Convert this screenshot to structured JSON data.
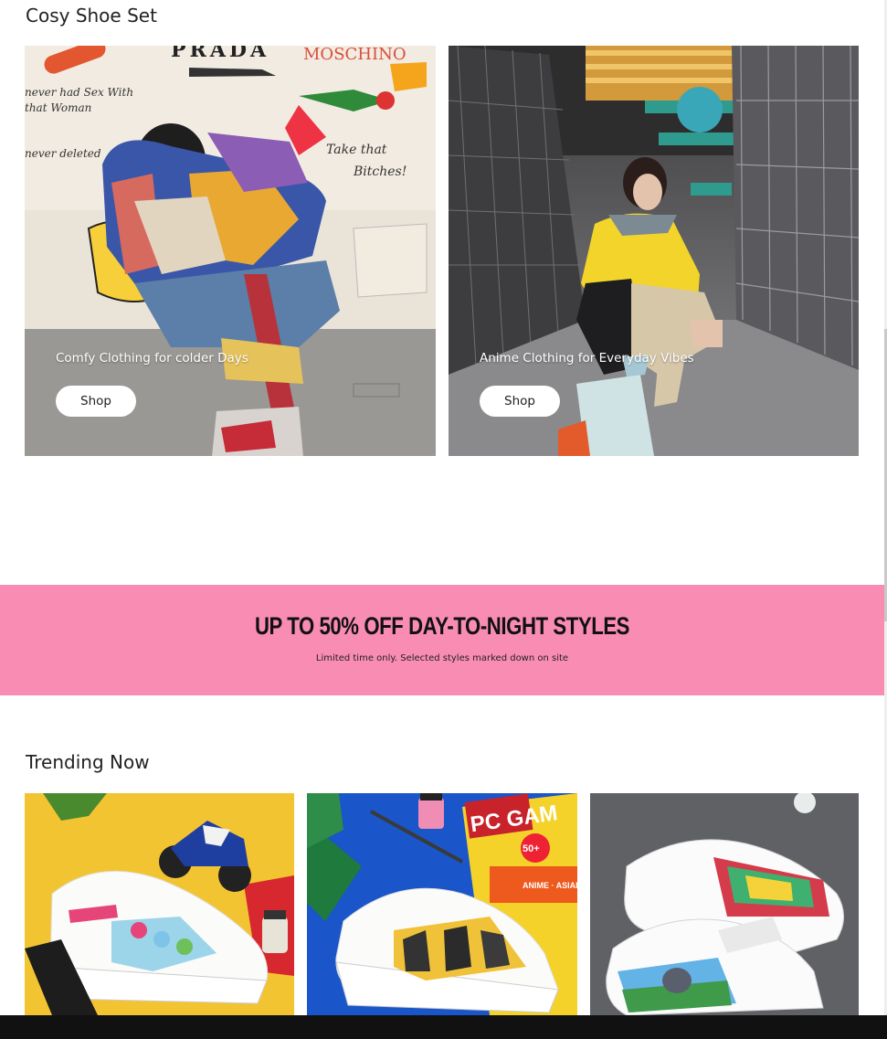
{
  "sections": {
    "featured_title": "Cosy Shoe Set",
    "trending_title": "Trending Now"
  },
  "cards": [
    {
      "caption": "Comfy Clothing for colder Days",
      "button_label": "Shop"
    },
    {
      "caption": "Anime Clothing for Everyday Vibes",
      "button_label": "Shop"
    }
  ],
  "artwork_text": {
    "brand_1": "PRADA",
    "brand_2": "MOSCHINO",
    "wall_line_1": "never had Sex With",
    "wall_line_2": "that Woman",
    "wall_line_3": "never deleted",
    "wall_line_4": "Take that",
    "wall_line_5": "Bitches!",
    "magazine_title": "PC GAM",
    "magazine_badge": "50+",
    "magazine_line": "ANIME · ASIAN"
  },
  "promo": {
    "headline": "UP TO 50% OFF DAY-TO-NIGHT STYLES",
    "subtext": "Limited time only. Selected styles marked down on site",
    "background_color": "#f98cb2"
  },
  "trending": [
    {
      "background": "#f3c431"
    },
    {
      "background": "#1a55c9"
    },
    {
      "background": "#5f6165"
    }
  ]
}
